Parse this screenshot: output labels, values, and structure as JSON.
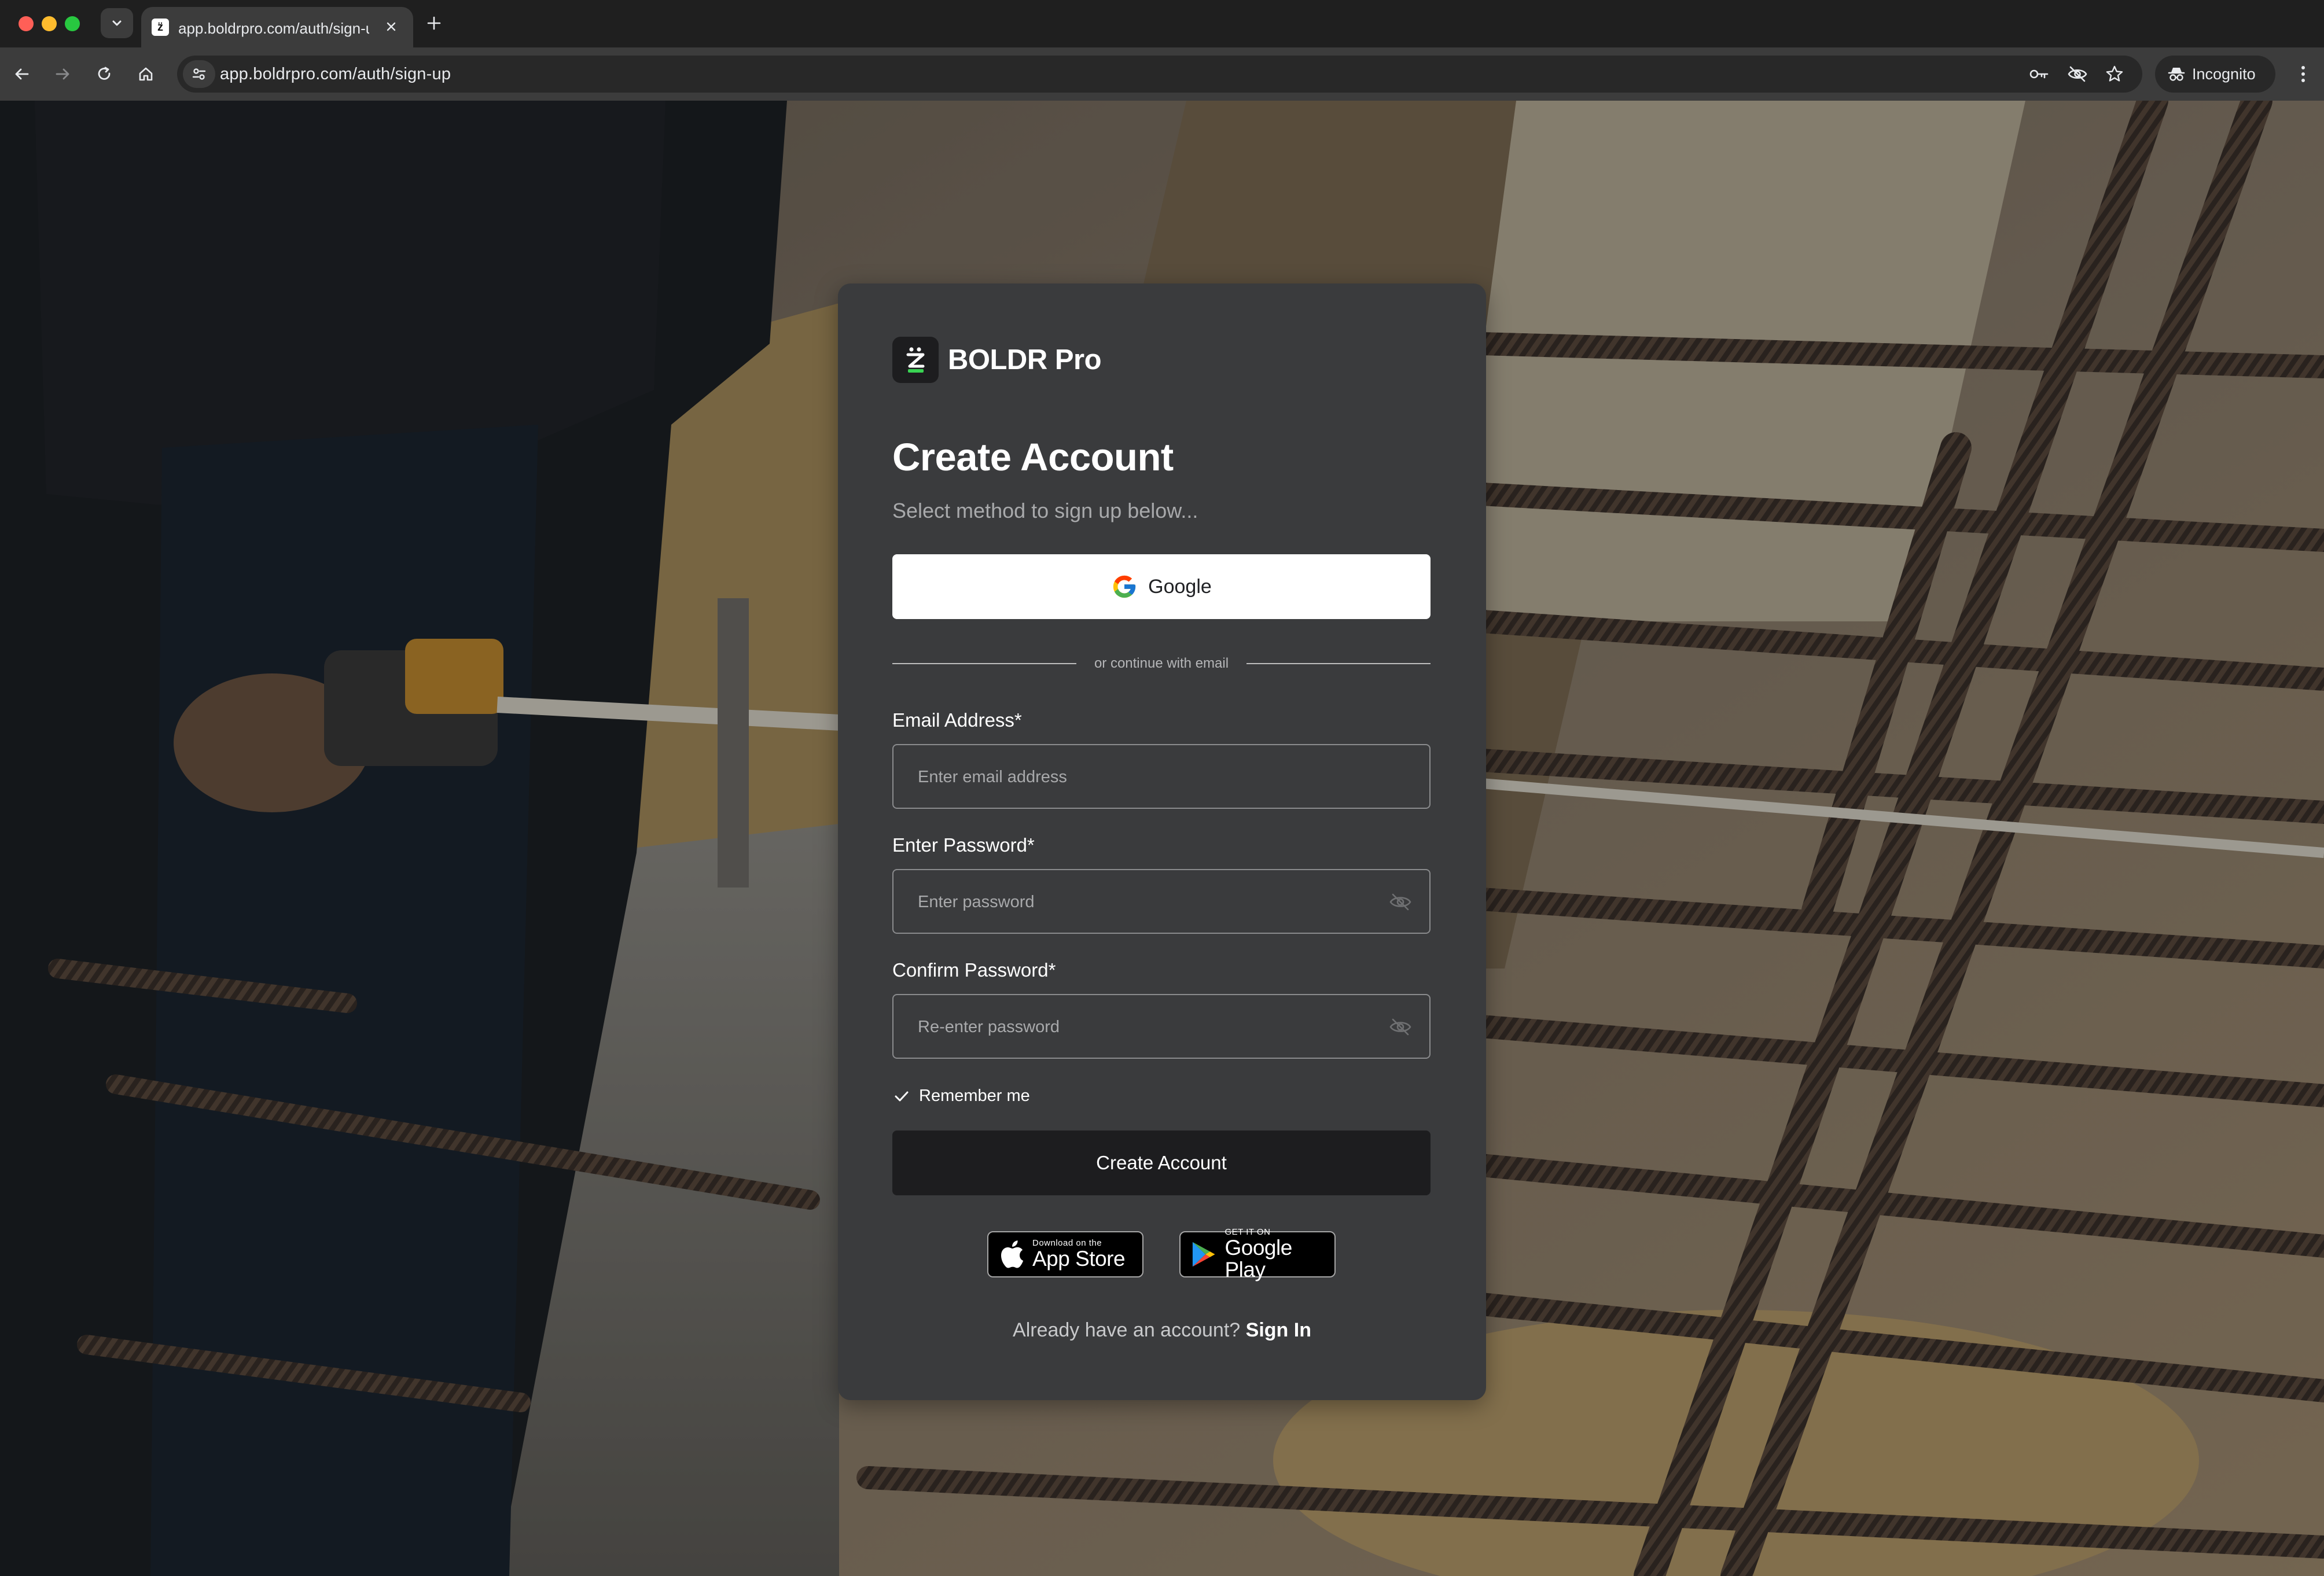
{
  "browser": {
    "tab_title": "app.boldrpro.com/auth/sign-up",
    "url": "app.boldrpro.com/auth/sign-up",
    "profile_label": "Incognito",
    "favicon_glyph": "z̈"
  },
  "brand": {
    "name": "BOLDR Pro",
    "logo_glyph": "z̈",
    "accent": "#39d353"
  },
  "form": {
    "title": "Create Account",
    "subtitle": "Select method to sign up below...",
    "google_label": "Google",
    "divider_text": "or continue with email",
    "email": {
      "label": "Email Address*",
      "placeholder": "Enter email address",
      "value": ""
    },
    "password": {
      "label": "Enter Password*",
      "placeholder": "Enter password",
      "value": ""
    },
    "confirm": {
      "label": "Confirm Password*",
      "placeholder": "Re-enter password",
      "value": ""
    },
    "remember_label": "Remember me",
    "remember_checked": true,
    "submit_label": "Create Account"
  },
  "stores": {
    "app_store": {
      "small": "Download on the",
      "big": "App Store"
    },
    "google_play": {
      "small": "GET IT ON",
      "big": "Google Play"
    }
  },
  "footer": {
    "prompt": "Already have an account?",
    "link": "Sign In"
  },
  "colors": {
    "card_bg": "#3a3b3d",
    "primary_button": "#1d1d1f"
  }
}
